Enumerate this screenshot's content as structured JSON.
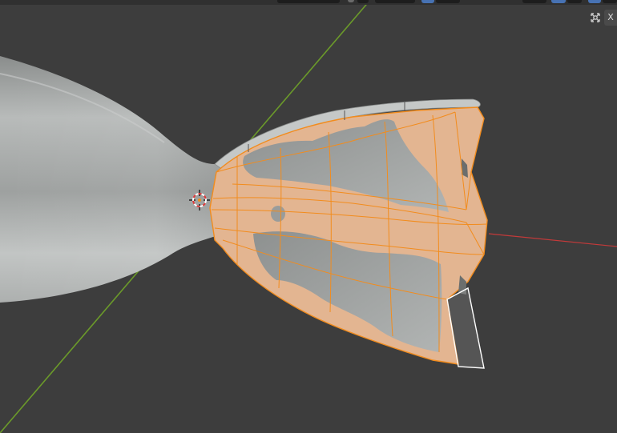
{
  "viewport": {
    "background": "#3d3d3d",
    "axis_x_color": "#c43a3a",
    "axis_y_color": "#6b9a2a",
    "mesh_color": "#b6b9b8",
    "selection_color": "#f28c1d",
    "selection_fill": "#e6b895",
    "active_face_color": "#ffffff"
  },
  "overlays": {
    "gizmo_toggle_icon": "cross-arrows-icon",
    "sidebar_toggle_label": "X"
  },
  "header": {
    "widgets": [
      "snap-dropdown",
      "proportional-icon",
      "overlay-dropdown",
      "shading-toggle",
      "view-icon",
      "display-icon",
      "xray-icon"
    ]
  }
}
